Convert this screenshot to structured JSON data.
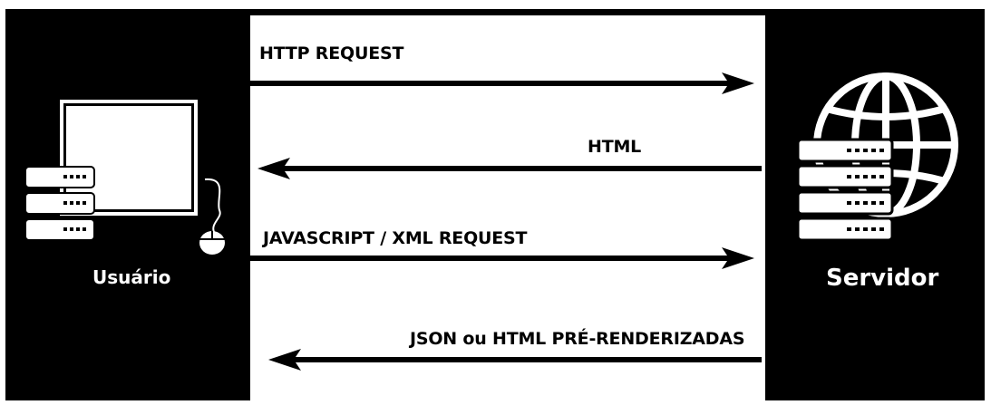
{
  "actors": {
    "client_label": "Usuário",
    "server_label": "Servidor"
  },
  "messages": [
    {
      "label": "HTTP REQUEST",
      "direction": "right"
    },
    {
      "label": "HTML",
      "direction": "left"
    },
    {
      "label": "JAVASCRIPT / XML REQUEST",
      "direction": "right"
    },
    {
      "label": "JSON ou HTML PRÉ-RENDERIZADAS",
      "direction": "left"
    }
  ],
  "icons": {
    "client": [
      "monitor-icon",
      "server-rack-icon",
      "mouse-icon"
    ],
    "server": [
      "globe-icon",
      "server-rack-icon"
    ]
  },
  "colors": {
    "background": "#000000",
    "panel": "#ffffff",
    "arrow": "#000000"
  }
}
